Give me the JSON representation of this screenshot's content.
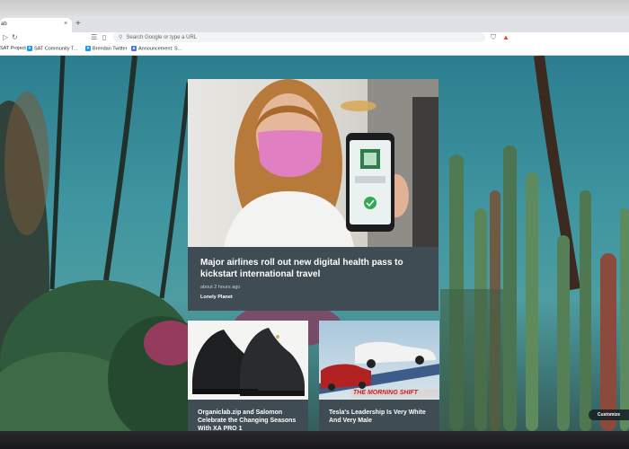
{
  "browser": {
    "tab_title": "ab",
    "tab_close": "×",
    "new_tab": "+",
    "omnibox_placeholder": "Search Google or type a URL",
    "bookmarks": [
      {
        "label": "SAT Project"
      },
      {
        "label": "SAT Community T..."
      },
      {
        "label": "Brendan Twitter"
      },
      {
        "label": "Announcement: S..."
      }
    ],
    "icons": {
      "back": "back-arrow-icon",
      "reload": "reload-icon",
      "search": "search-icon",
      "shield": "brave-shield-icon",
      "rewards": "brave-rewards-icon"
    },
    "colors": {
      "accent": "#e8472b",
      "card_bg": "#3f4c53"
    }
  },
  "feed": {
    "featured": {
      "title": "Major airlines roll out new digital health pass to kickstart international travel",
      "time": "about 2 hours ago",
      "source": "Lonely Planet"
    },
    "cards": [
      {
        "title": "Organiclab.zip and Salomon Celebrate the Changing Seasons With XA PRO 1"
      },
      {
        "title": "Tesla's Leadership Is Very White And Very Male",
        "banner": "THE MORNING SHIFT"
      }
    ]
  },
  "customize_label": "Customize"
}
